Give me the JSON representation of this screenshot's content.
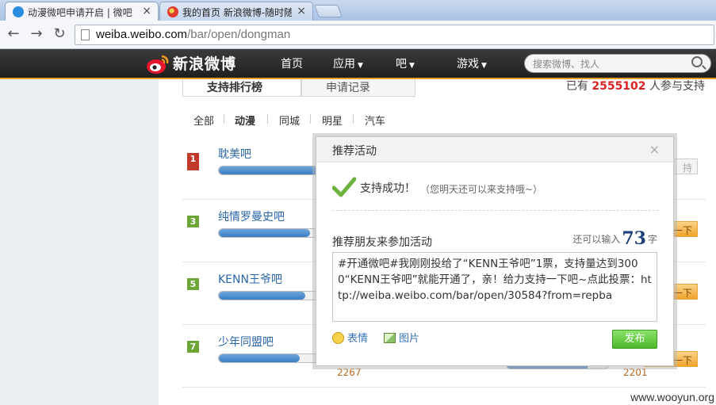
{
  "browser": {
    "tabs": [
      {
        "title": "动漫微吧申请开启 | 微吧",
        "active": true
      },
      {
        "title": "我的首页 新浪微博-随时随",
        "active": false
      }
    ],
    "close_glyph": "×",
    "url_host": "weiba.weibo.com",
    "url_path": "/bar/open/dongman"
  },
  "weibo_nav": {
    "logo": "新浪微博",
    "links": [
      "首页",
      "应用",
      "吧",
      "游戏"
    ],
    "search_placeholder": "搜索微博、找人"
  },
  "page": {
    "tabs": [
      "支持排行榜",
      "申请记录"
    ],
    "count_prefix": "已有",
    "count_value": "2555102",
    "count_suffix": "人参与支持",
    "categories": [
      "全部",
      "动漫",
      "同城",
      "明星",
      "汽车"
    ],
    "selected_category": "动漫",
    "rows": [
      {
        "rank": "1",
        "name": "耽美吧",
        "progress": 1.0,
        "button": "持"
      },
      {
        "rank": "3",
        "name": "纯情罗曼史吧",
        "progress": 0.9,
        "button": "一下"
      },
      {
        "rank": "5",
        "name": "KENN王爷吧",
        "progress": 0.85,
        "button": "一下"
      },
      {
        "rank": "7",
        "name": "少年同盟吧",
        "progress": 0.8,
        "votes": "2267",
        "button": "一下",
        "right_votes": "2201"
      }
    ]
  },
  "modal": {
    "title": "推荐活动",
    "close": "×",
    "success": "支持成功！",
    "success_hint": "（您明天还可以来支持哦~）",
    "invite_label": "推荐朋友来参加活动",
    "quota_prefix": "还可以输入",
    "quota_value": "73",
    "quota_suffix": "字",
    "share_text": "#开通微吧#我刚刚投给了“KENN王爷吧”1票，支持量达到3000“KENN王爷吧”就能开通了，亲！给力支持一下吧~点此投票：http://weiba.weibo.com/bar/open/30584?from=repba",
    "emoji_label": "表情",
    "image_label": "图片",
    "publish_label": "发布"
  },
  "watermark": "www.wooyun.org",
  "colors": {
    "accent_orange": "#e5a020",
    "link_blue": "#2a66a8",
    "publish_green": "#4cb82a"
  }
}
